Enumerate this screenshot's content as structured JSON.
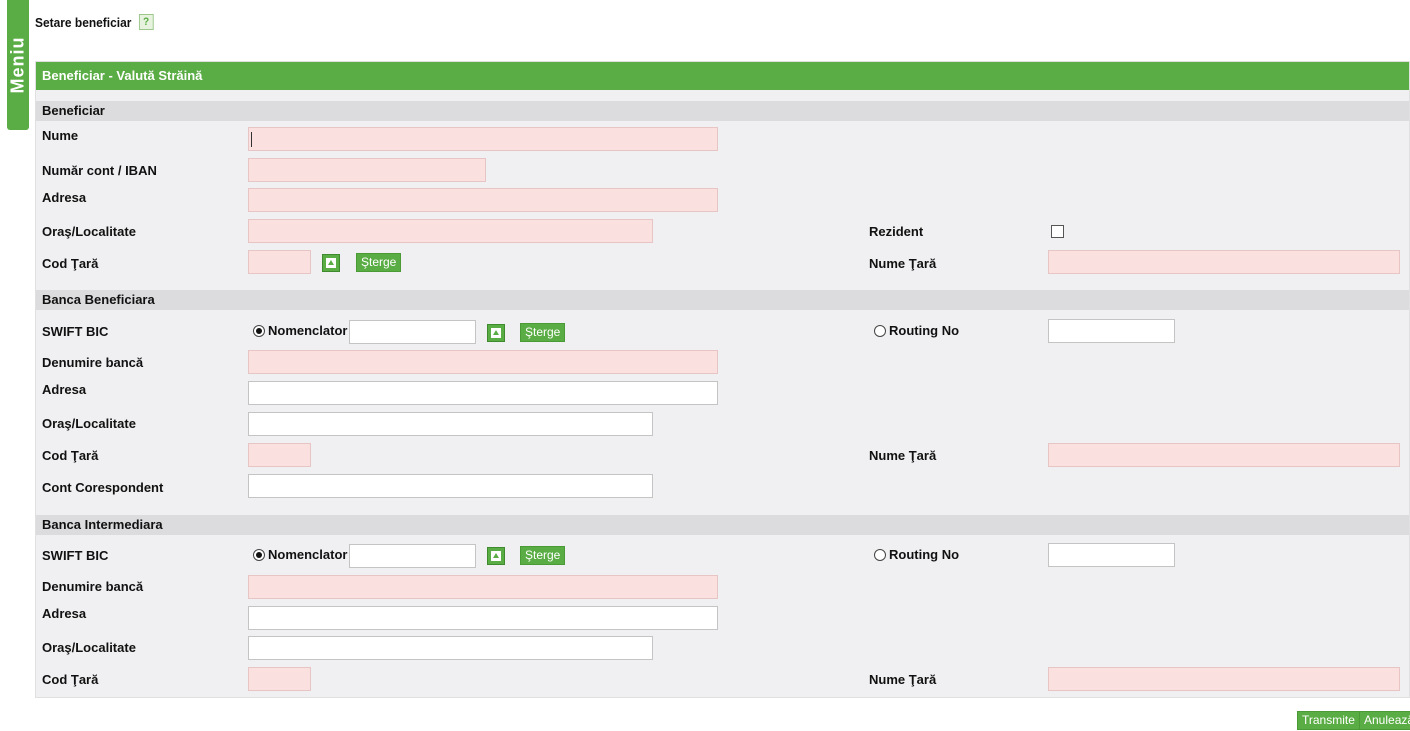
{
  "menu_tab_label": "Meniu",
  "page_title": "Setare beneficiar",
  "help_label": "?",
  "panel_title": "Beneficiar - Valută Străină",
  "beneficiar": {
    "section_title": "Beneficiar",
    "nume_label": "Nume",
    "cont_label": "Număr cont / IBAN",
    "adresa_label": "Adresa",
    "oras_label": "Oraş/Localitate",
    "cod_tara_label": "Cod Ţară",
    "rezident_label": "Rezident",
    "nume_tara_label": "Nume Ţară",
    "sterge_label": "Şterge",
    "rezident_checked": false
  },
  "banca_beneficiara": {
    "section_title": "Banca Beneficiara",
    "swift_label": "SWIFT BIC",
    "nomenclator_label": "Nomenclator",
    "sterge_label": "Şterge",
    "routing_label": "Routing No",
    "denumire_label": "Denumire bancă",
    "adresa_label": "Adresa",
    "oras_label": "Oraş/Localitate",
    "cod_tara_label": "Cod Ţară",
    "nume_tara_label": "Nume Ţară",
    "cont_corespondent_label": "Cont Corespondent"
  },
  "banca_intermediara": {
    "section_title": "Banca Intermediara",
    "swift_label": "SWIFT BIC",
    "nomenclator_label": "Nomenclator",
    "sterge_label": "Şterge",
    "routing_label": "Routing No",
    "denumire_label": "Denumire bancă",
    "adresa_label": "Adresa",
    "oras_label": "Oraş/Localitate",
    "cod_tara_label": "Cod Ţară",
    "nume_tara_label": "Nume Ţară"
  },
  "footer": {
    "transmite_label": "Transmite",
    "anuleaza_label": "Anulează"
  },
  "colors": {
    "accent": "#5aac44",
    "required_field": "#fbe0e0",
    "panel_bg": "#f0f0f2",
    "section_bg": "#dcdcde"
  }
}
